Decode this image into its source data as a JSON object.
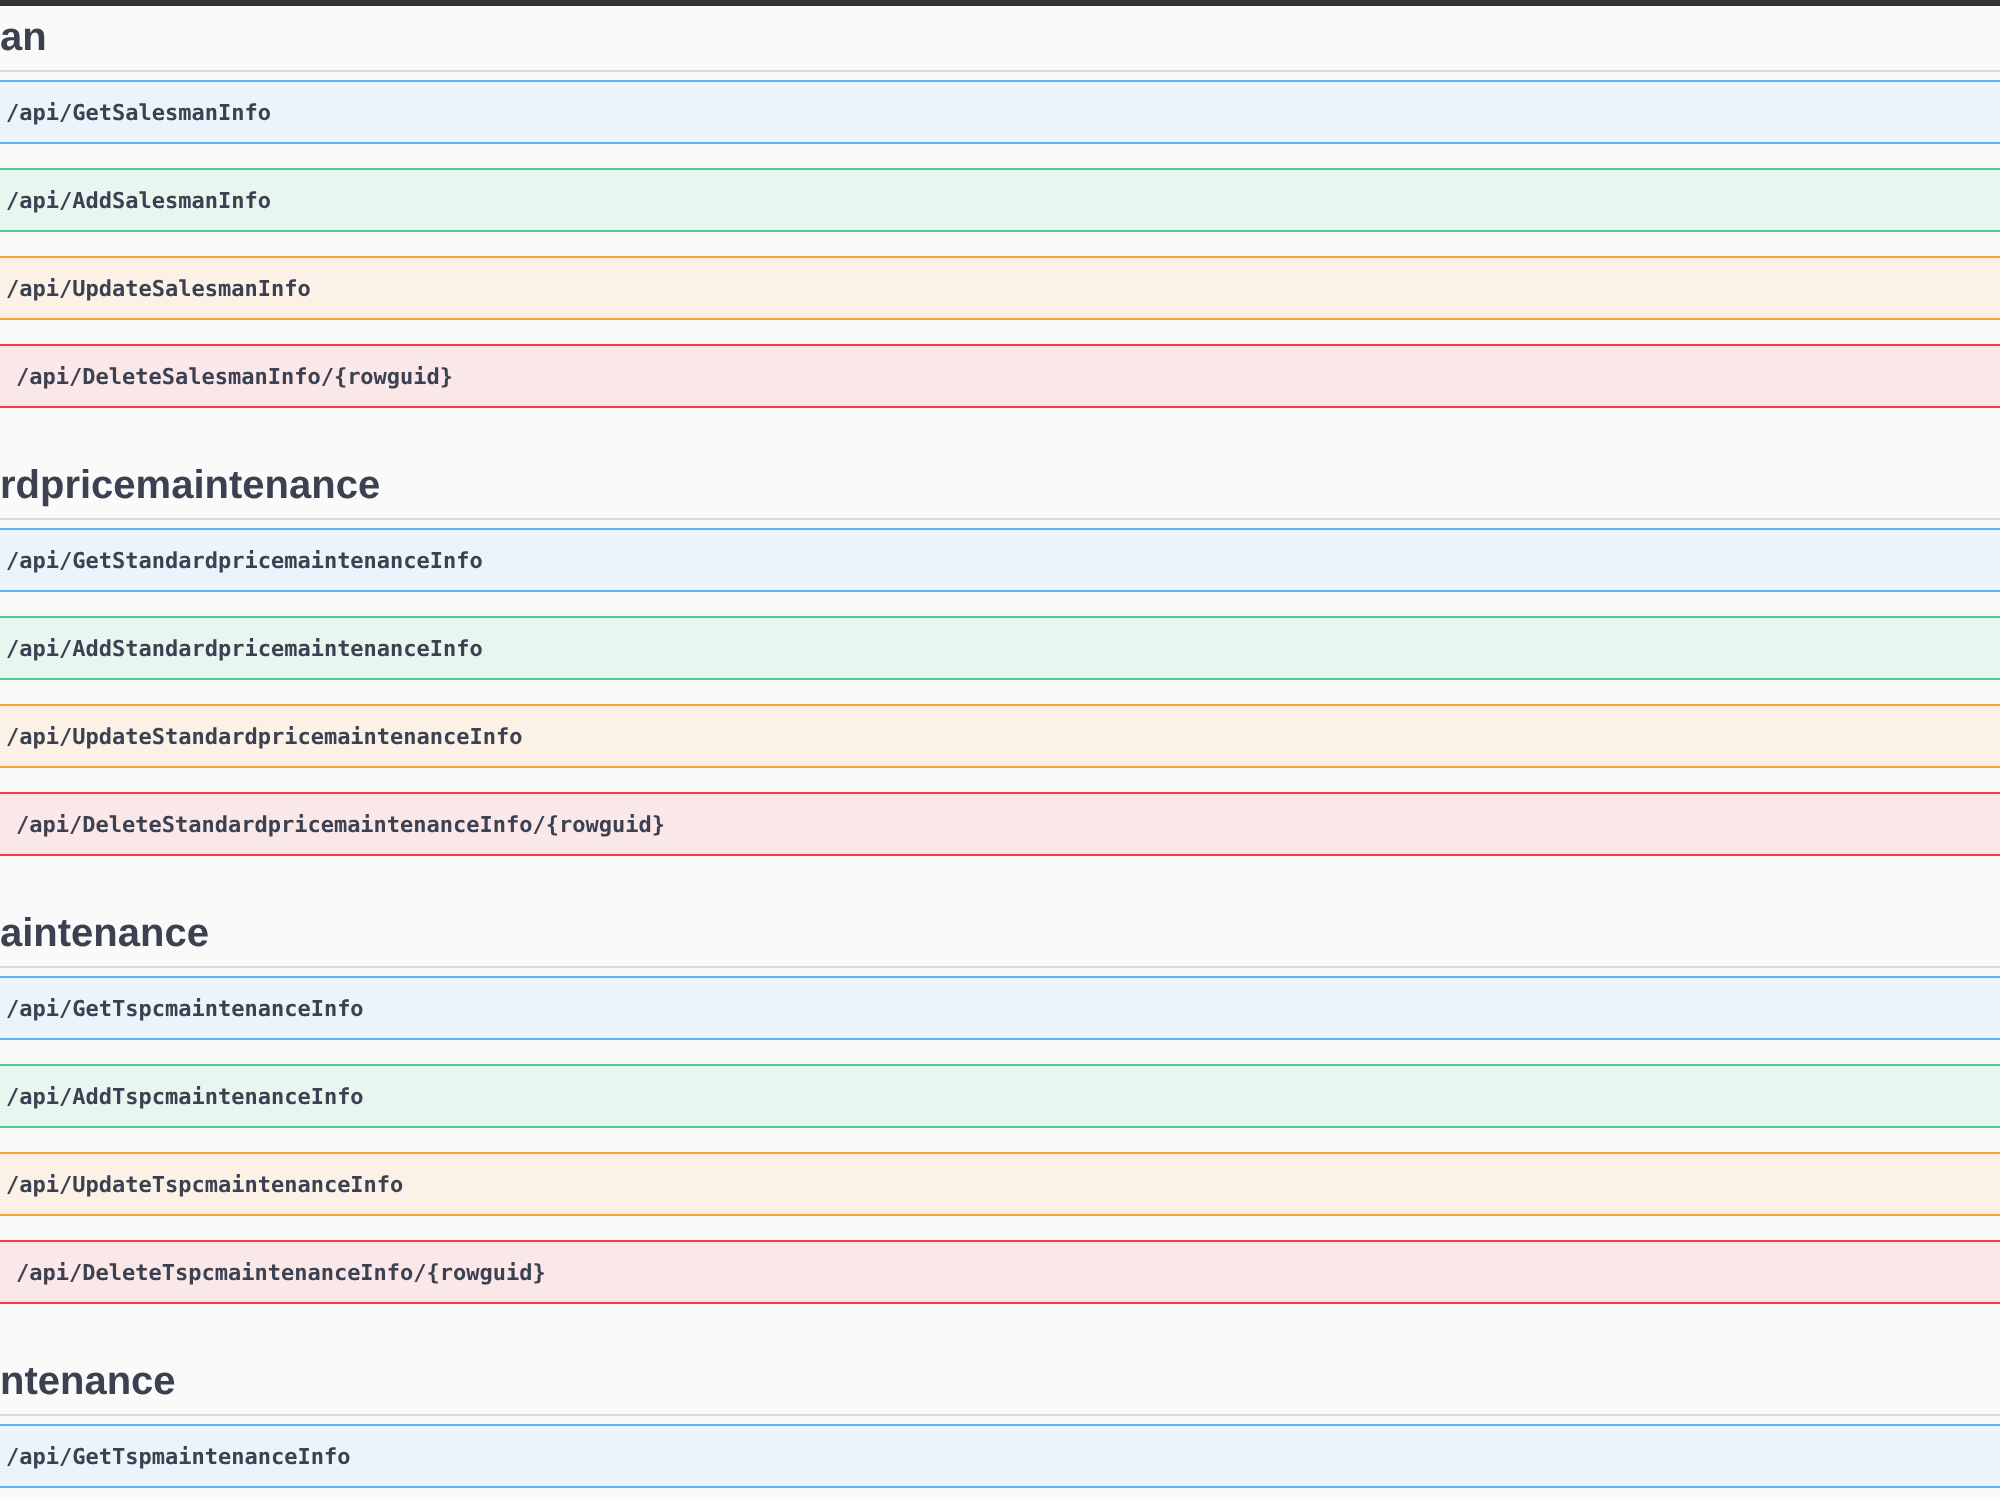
{
  "sections": [
    {
      "title": "an",
      "endpoints": [
        {
          "kind": "get",
          "path": "/api/GetSalesmanInfo"
        },
        {
          "kind": "post",
          "path": "/api/AddSalesmanInfo"
        },
        {
          "kind": "put",
          "path": "/api/UpdateSalesmanInfo"
        },
        {
          "kind": "delete",
          "path": "/api/DeleteSalesmanInfo/{rowguid}"
        }
      ]
    },
    {
      "title": "rdpricemaintenance",
      "endpoints": [
        {
          "kind": "get",
          "path": "/api/GetStandardpricemaintenanceInfo"
        },
        {
          "kind": "post",
          "path": "/api/AddStandardpricemaintenanceInfo"
        },
        {
          "kind": "put",
          "path": "/api/UpdateStandardpricemaintenanceInfo"
        },
        {
          "kind": "delete",
          "path": "/api/DeleteStandardpricemaintenanceInfo/{rowguid}"
        }
      ]
    },
    {
      "title": "aintenance",
      "endpoints": [
        {
          "kind": "get",
          "path": "/api/GetTspcmaintenanceInfo"
        },
        {
          "kind": "post",
          "path": "/api/AddTspcmaintenanceInfo"
        },
        {
          "kind": "put",
          "path": "/api/UpdateTspcmaintenanceInfo"
        },
        {
          "kind": "delete",
          "path": "/api/DeleteTspcmaintenanceInfo/{rowguid}"
        }
      ]
    },
    {
      "title": "ntenance",
      "endpoints": [
        {
          "kind": "get",
          "path": "/api/GetTspmaintenanceInfo"
        }
      ]
    }
  ]
}
